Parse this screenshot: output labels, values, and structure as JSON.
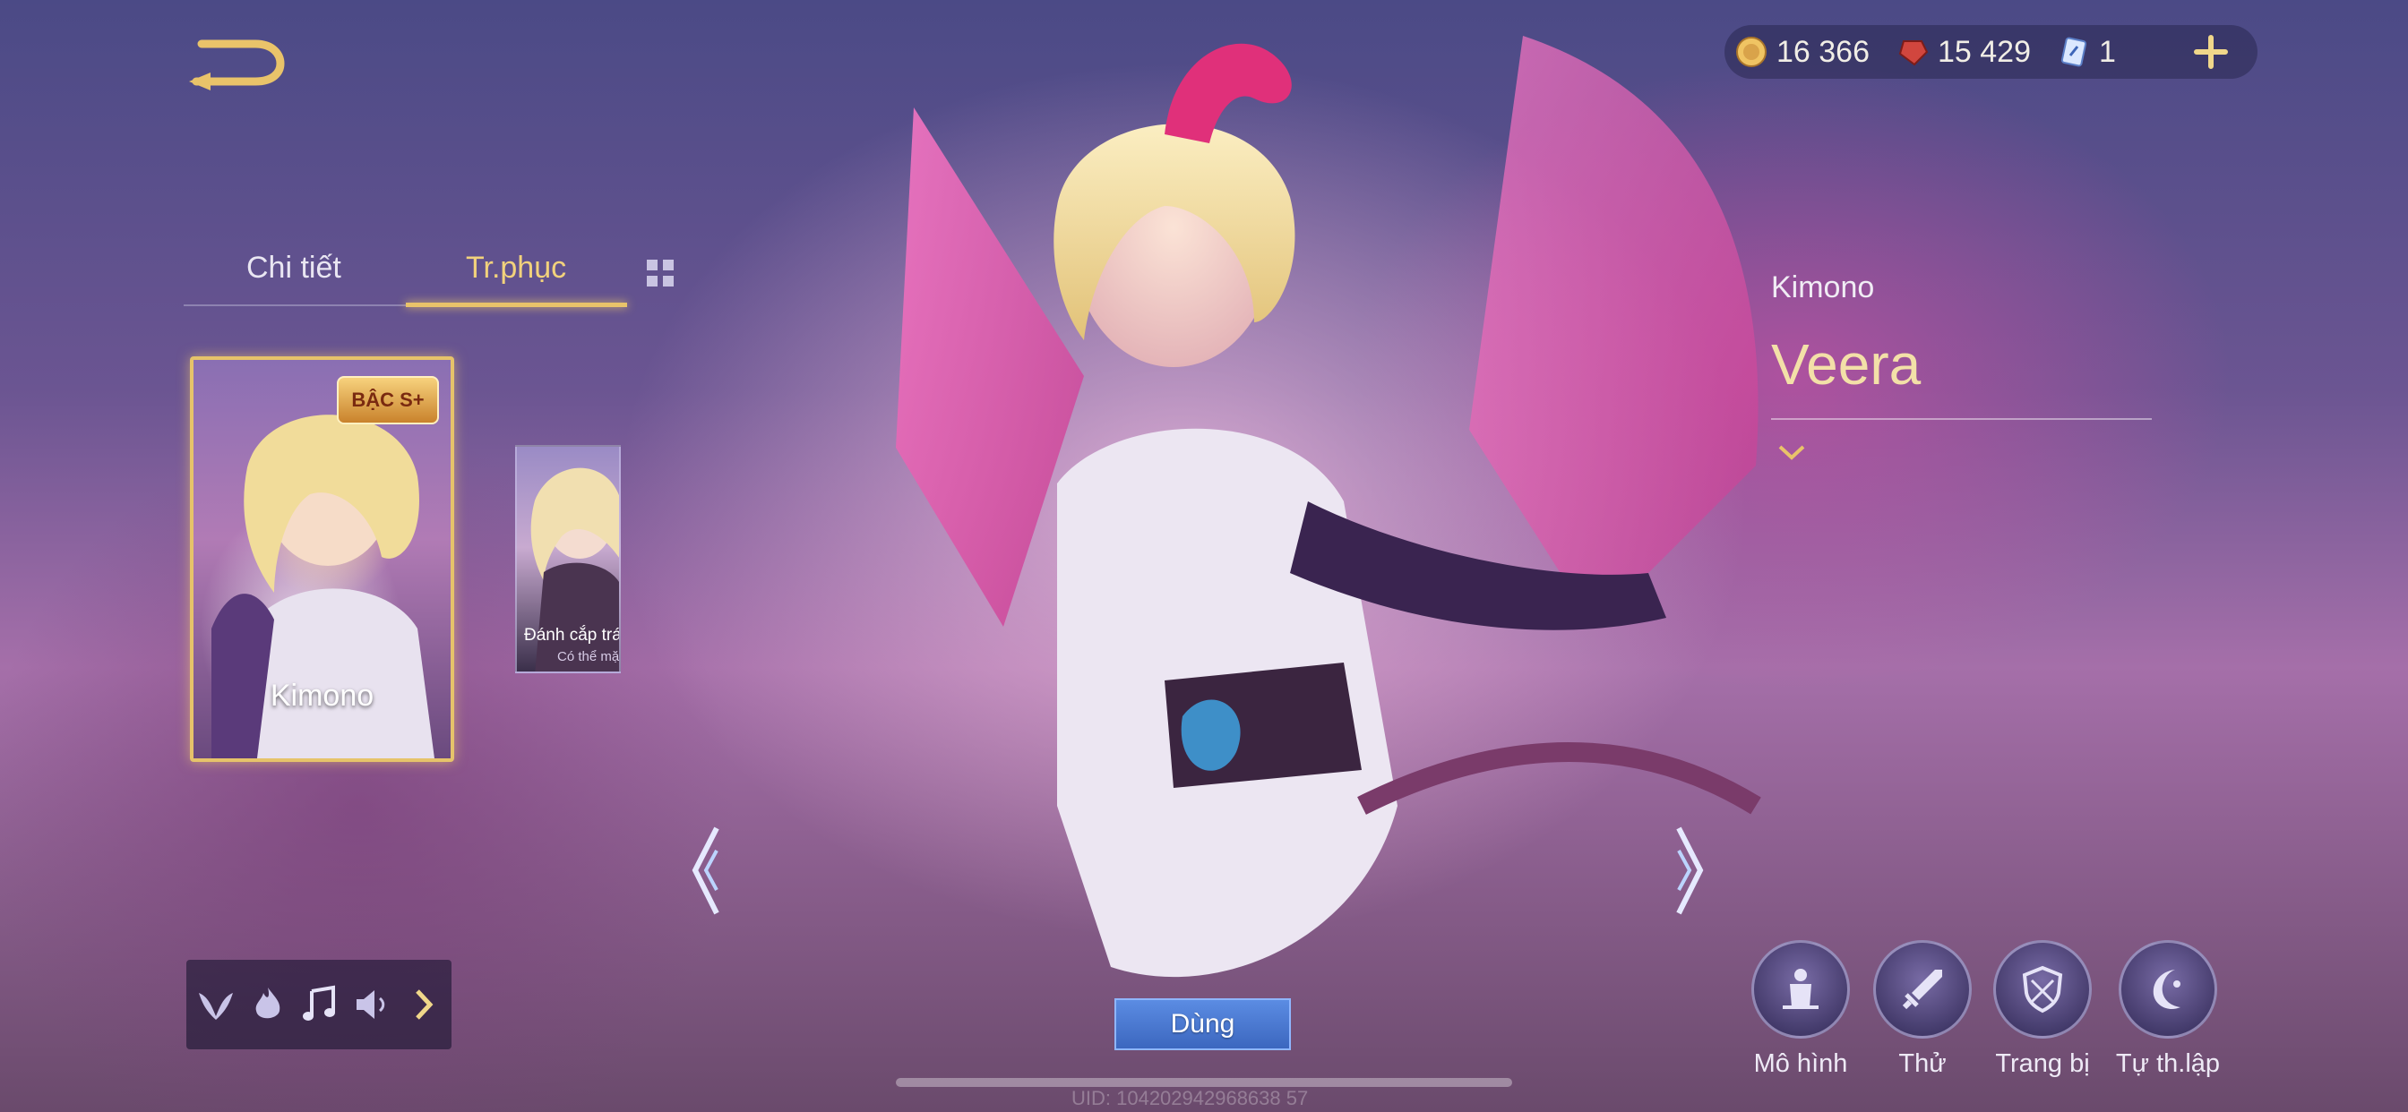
{
  "header": {
    "back_icon": "back-arrow-icon",
    "currencies": [
      {
        "name": "gold",
        "icon": "gold-coin-icon",
        "value": "16 366"
      },
      {
        "name": "gem",
        "icon": "red-gem-icon",
        "value": "15 429"
      },
      {
        "name": "voucher",
        "icon": "voucher-card-icon",
        "value": "1"
      }
    ],
    "plus_icon": "plus-icon"
  },
  "tabs": [
    {
      "label": "Chi tiết",
      "active": false
    },
    {
      "label": "Tr.phục",
      "active": true
    }
  ],
  "skins": [
    {
      "label": "Kimono",
      "badge": "BẬC S+",
      "selected": true
    },
    {
      "label": "Đánh cắp trá",
      "sub": "Có thể mặ",
      "selected": false
    }
  ],
  "hero": {
    "skin_name": "Kimono",
    "hero_name": "Veera"
  },
  "effects": [
    "wing-icon",
    "flame-icon",
    "music-icon",
    "speaker-icon",
    "chevron-right-icon"
  ],
  "use_button": "Dùng",
  "uid": "UID: 104202942968638 57",
  "actions": [
    {
      "label": "Mô hình",
      "icon": "model-icon"
    },
    {
      "label": "Thử",
      "icon": "sword-icon"
    },
    {
      "label": "Trang bị",
      "icon": "shield-icon"
    },
    {
      "label": "Tự th.lập",
      "icon": "moon-icon"
    }
  ],
  "colors": {
    "accent_gold": "#e9c36a",
    "hero_name": "#f3e0a8",
    "use_button": "#4a78d2"
  }
}
